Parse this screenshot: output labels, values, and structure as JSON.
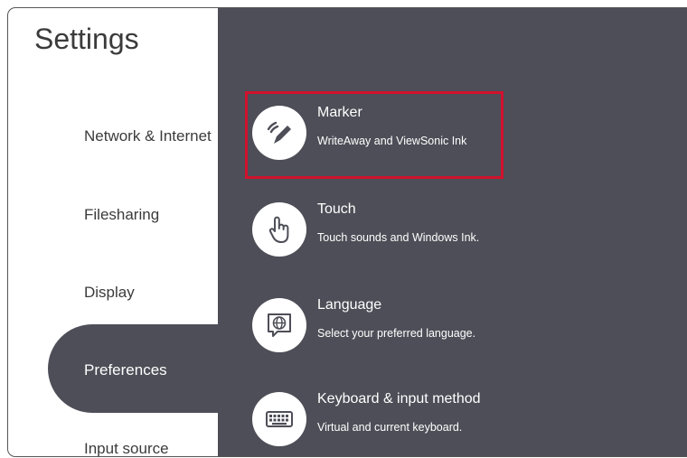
{
  "sidebar": {
    "title": "Settings",
    "items": [
      {
        "label": "Network & Internet"
      },
      {
        "label": "Filesharing"
      },
      {
        "label": "Display"
      },
      {
        "label": "Preferences",
        "selected": true
      },
      {
        "label": "Input source"
      }
    ]
  },
  "preferences": {
    "items": [
      {
        "title": "Marker",
        "subtitle": "WriteAway and ViewSonic Ink",
        "icon": "marker-pen-icon",
        "highlighted": true
      },
      {
        "title": "Touch",
        "subtitle": "Touch sounds and Windows Ink.",
        "icon": "touch-hand-icon"
      },
      {
        "title": "Language",
        "subtitle": "Select your preferred language.",
        "icon": "language-globe-icon"
      },
      {
        "title": "Keyboard & input method",
        "subtitle": "Virtual and current keyboard.",
        "icon": "keyboard-icon"
      }
    ]
  },
  "colors": {
    "panel": "#4e4e58",
    "sidebar": "#ffffff",
    "highlight": "#d0122d"
  }
}
